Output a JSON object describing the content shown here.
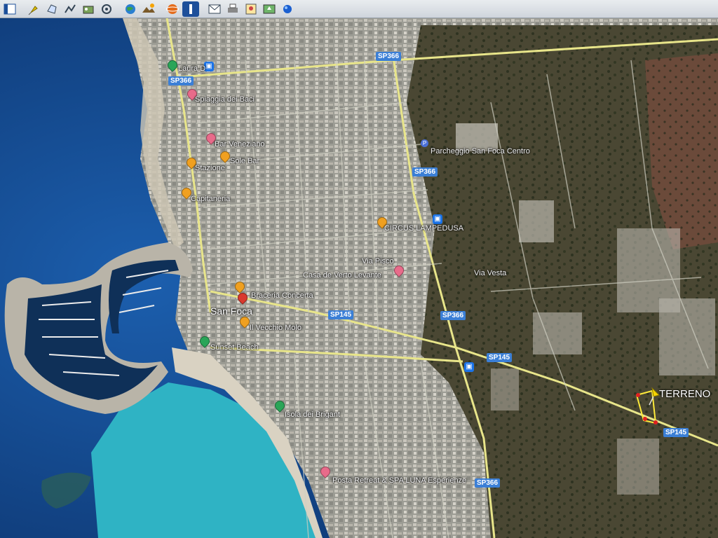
{
  "toolbar": {
    "icons": [
      "sidebar-toggle-icon",
      "pushpin-icon",
      "polygon-icon",
      "path-icon",
      "circle-icon",
      "tour-icon",
      "historical-imagery-icon",
      "planets-icon",
      "sky-icon",
      "ruler-icon",
      "email-icon",
      "print-icon",
      "save-image-icon",
      "view-in-maps-icon",
      "google-earth-icon"
    ]
  },
  "map": {
    "town_label": "San Foca",
    "roads": [
      {
        "id": "sp366-n",
        "text": "SP366"
      },
      {
        "id": "sp366-top",
        "text": "SP366"
      },
      {
        "id": "sp366-mid",
        "text": "SP366"
      },
      {
        "id": "sp366-e",
        "text": "SP366"
      },
      {
        "id": "sp366-s",
        "text": "SP366"
      },
      {
        "id": "sp145-w",
        "text": "SP145"
      },
      {
        "id": "sp145-c",
        "text": "SP145"
      },
      {
        "id": "sp145-e",
        "text": "SP145"
      }
    ],
    "places": [
      {
        "id": "laura",
        "text": "Laura D"
      },
      {
        "id": "spiaggia",
        "text": "Spiaggia dei Baci"
      },
      {
        "id": "bar",
        "text": "Bar Veneziano"
      },
      {
        "id": "sole",
        "text": "Sole Bar"
      },
      {
        "id": "corso",
        "text": "Stazione"
      },
      {
        "id": "capitaneria",
        "text": "Capitaneria"
      },
      {
        "id": "parcheggio",
        "text": "Parcheggio San Foca Centro"
      },
      {
        "id": "circus",
        "text": "CIRCUS LAMPEDUSA"
      },
      {
        "id": "via-pisco",
        "text": "Via Pisco"
      },
      {
        "id": "casa",
        "text": "Casa de Verto Levante"
      },
      {
        "id": "via-vesta",
        "text": "Via Vesta"
      },
      {
        "id": "concerta",
        "text": "Braceria Concerta"
      },
      {
        "id": "vecchio",
        "text": "Il Vecchio Molo"
      },
      {
        "id": "sunset",
        "text": "Sunset Beach"
      },
      {
        "id": "isola",
        "text": "Isola dei Brigant"
      },
      {
        "id": "posta",
        "text": "Posta Retreat & SPA LUNA Esperienze"
      },
      {
        "id": "terreno",
        "text": "TERRENO"
      }
    ],
    "colors": {
      "sea_deep": "#0f3a78",
      "sea_shallow": "#2fb6c8",
      "beach": "#d9d2c2",
      "town": "#a9a9a2",
      "fields": "#4d4a37",
      "roads": "#e8e58a",
      "pin_orange": "#f0a020"
    }
  }
}
